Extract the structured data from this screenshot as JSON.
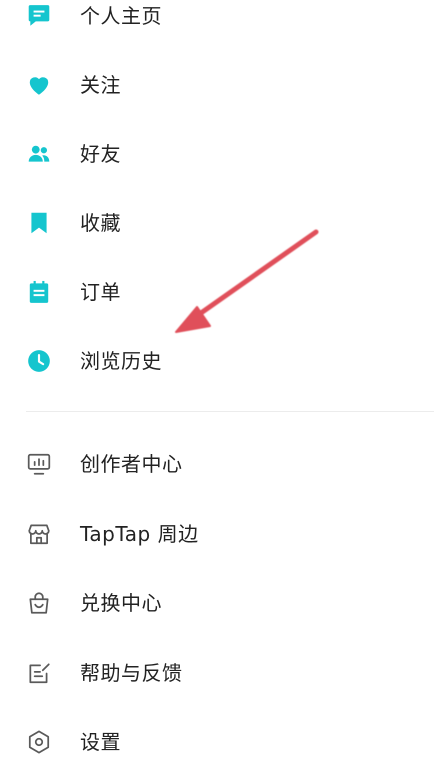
{
  "colors": {
    "accent": "#15c5ce",
    "secondary_icon": "#5a5a5a",
    "arrow": "#e0505a"
  },
  "primary_items": [
    {
      "label": "个人主页",
      "icon": "chat-bubble-icon"
    },
    {
      "label": "关注",
      "icon": "heart-icon"
    },
    {
      "label": "好友",
      "icon": "friends-icon"
    },
    {
      "label": "收藏",
      "icon": "bookmark-icon"
    },
    {
      "label": "订单",
      "icon": "order-icon"
    },
    {
      "label": "浏览历史",
      "icon": "clock-icon"
    }
  ],
  "secondary_items": [
    {
      "label": "创作者中心",
      "icon": "monitor-chart-icon"
    },
    {
      "label": "TapTap 周边",
      "icon": "shop-icon"
    },
    {
      "label": "兑换中心",
      "icon": "gift-bag-icon"
    },
    {
      "label": "帮助与反馈",
      "icon": "feedback-edit-icon"
    },
    {
      "label": "设置",
      "icon": "settings-hexagon-icon"
    }
  ]
}
